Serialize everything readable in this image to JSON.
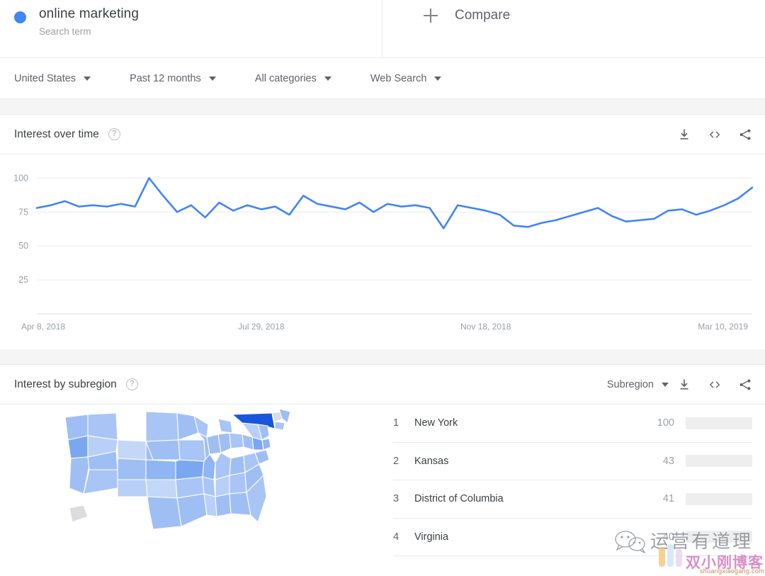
{
  "search_term": {
    "title": "online marketing",
    "subtitle": "Search term",
    "dot_color": "#4285f4"
  },
  "compare": {
    "label": "Compare",
    "icon": "plus-icon"
  },
  "filters": [
    {
      "label": "United States",
      "icon": "chevron-down-icon"
    },
    {
      "label": "Past 12 months",
      "icon": "chevron-down-icon"
    },
    {
      "label": "All categories",
      "icon": "chevron-down-icon"
    },
    {
      "label": "Web Search",
      "icon": "chevron-down-icon"
    }
  ],
  "interest_over_time": {
    "title": "Interest over time",
    "help_icon": "?",
    "tools": [
      {
        "name": "download-icon"
      },
      {
        "name": "embed-code-icon"
      },
      {
        "name": "share-icon"
      }
    ]
  },
  "interest_by_subregion": {
    "title": "Interest by subregion",
    "help_icon": "?",
    "select_label": "Subregion",
    "tools": [
      {
        "name": "download-icon"
      },
      {
        "name": "embed-code-icon"
      },
      {
        "name": "share-icon"
      }
    ],
    "rows": [
      {
        "rank": "1",
        "name": "New York",
        "value": "100",
        "pct": 100
      },
      {
        "rank": "2",
        "name": "Kansas",
        "value": "43",
        "pct": 43
      },
      {
        "rank": "3",
        "name": "District of Columbia",
        "value": "41",
        "pct": 41
      },
      {
        "rank": "4",
        "name": "Virginia",
        "value": "40",
        "pct": 40
      }
    ],
    "map": {
      "highlight_state": "New York",
      "highlight_color": "#1a56db",
      "no_data_color": "#dadce0"
    }
  },
  "watermark": {
    "wechat_text": "运营有道理",
    "blog_text": "双小刚博客",
    "url_text": "shuangxiaogang.com"
  },
  "chart_data": {
    "type": "line",
    "title": "Interest over time",
    "xlabel": "",
    "ylabel": "",
    "ylim": [
      0,
      108
    ],
    "yticks": [
      25,
      50,
      75,
      100
    ],
    "grid": true,
    "line_color": "#4285f4",
    "xticks": [
      "Apr 8, 2018",
      "Jul 29, 2018",
      "Nov 18, 2018",
      "Mar 10, 2019"
    ],
    "xtick_positions": [
      0,
      16,
      32,
      48
    ],
    "x": [
      0,
      1,
      2,
      3,
      4,
      5,
      6,
      7,
      8,
      9,
      10,
      11,
      12,
      13,
      14,
      15,
      16,
      17,
      18,
      19,
      20,
      21,
      22,
      23,
      24,
      25,
      26,
      27,
      28,
      29,
      30,
      31,
      32,
      33,
      34,
      35,
      36,
      37,
      38,
      39,
      40,
      41,
      42,
      43,
      44,
      45,
      46,
      47,
      48,
      49,
      50,
      51
    ],
    "values": [
      78,
      80,
      83,
      79,
      80,
      79,
      81,
      79,
      100,
      87,
      75,
      80,
      71,
      82,
      76,
      80,
      77,
      79,
      73,
      87,
      81,
      79,
      77,
      82,
      75,
      81,
      79,
      80,
      78,
      63,
      80,
      78,
      76,
      73,
      65,
      64,
      67,
      69,
      72,
      75,
      78,
      72,
      68,
      69,
      70,
      76,
      77,
      73,
      76,
      80,
      85,
      93
    ],
    "series": [
      {
        "name": "online marketing",
        "values": [
          78,
          80,
          83,
          79,
          80,
          79,
          81,
          79,
          100,
          87,
          75,
          80,
          71,
          82,
          76,
          80,
          77,
          79,
          73,
          87,
          81,
          79,
          77,
          82,
          75,
          81,
          79,
          80,
          78,
          63,
          80,
          78,
          76,
          73,
          65,
          64,
          67,
          69,
          72,
          75,
          78,
          72,
          68,
          69,
          70,
          76,
          77,
          73,
          76,
          80,
          85,
          93
        ]
      }
    ]
  }
}
